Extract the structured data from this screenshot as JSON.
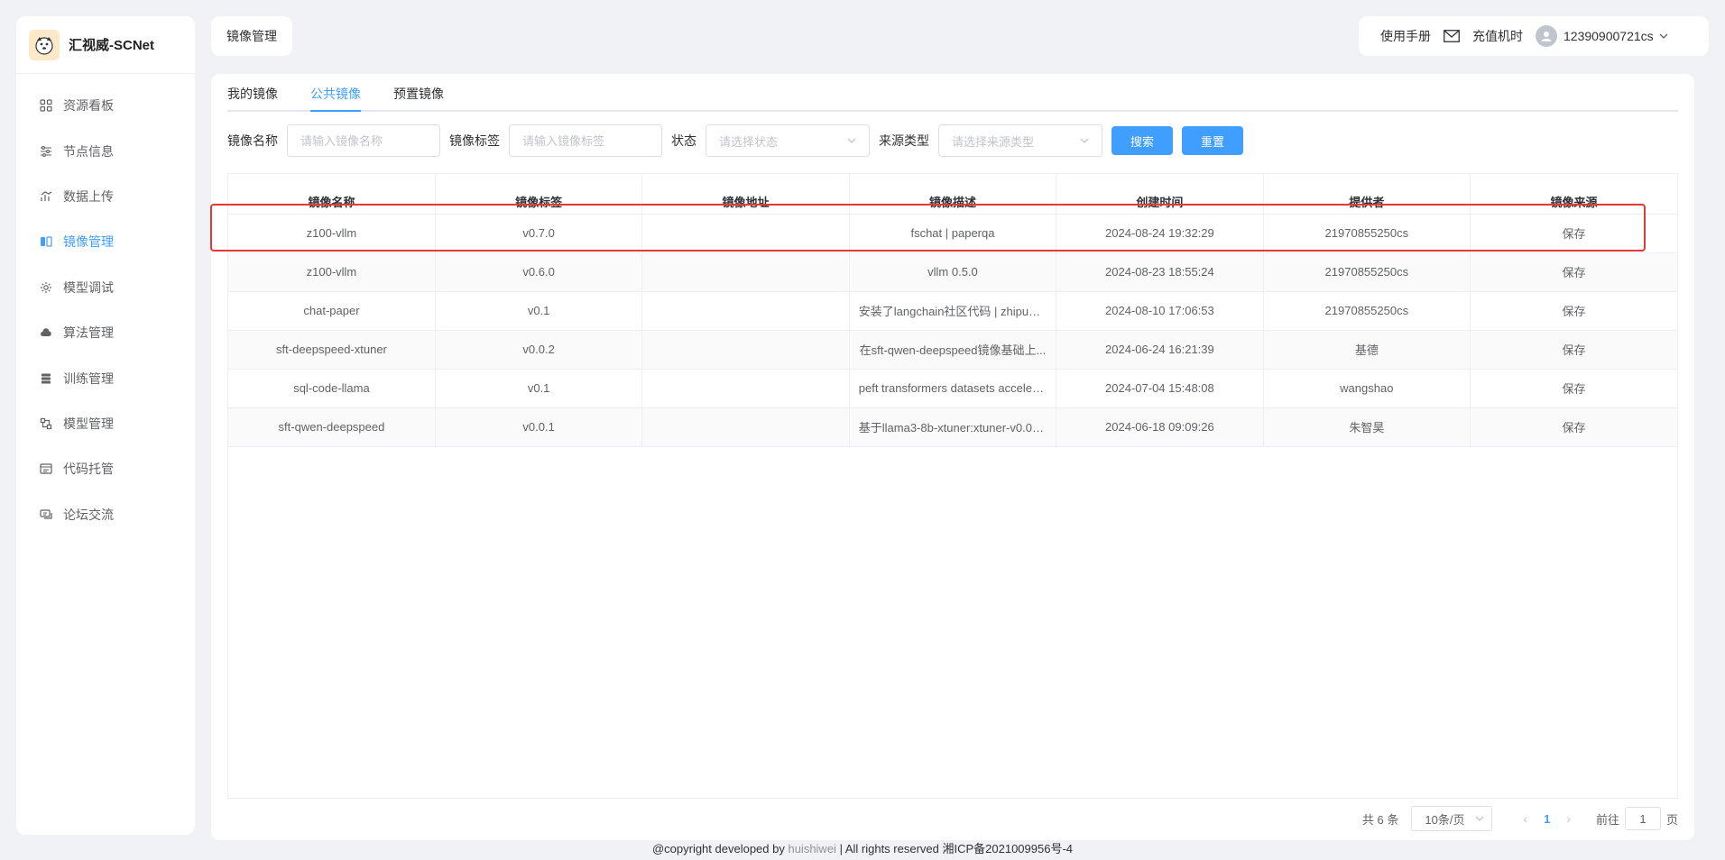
{
  "brand": {
    "title": "汇视威-SCNet"
  },
  "sidebar": {
    "items": [
      {
        "label": "资源看板",
        "icon": "grid-icon",
        "active": false
      },
      {
        "label": "节点信息",
        "icon": "sliders-icon",
        "active": false
      },
      {
        "label": "数据上传",
        "icon": "chart-icon",
        "active": false
      },
      {
        "label": "镜像管理",
        "icon": "mirror-icon",
        "active": true
      },
      {
        "label": "模型调试",
        "icon": "gear-icon",
        "active": false
      },
      {
        "label": "算法管理",
        "icon": "cloud-icon",
        "active": false
      },
      {
        "label": "训练管理",
        "icon": "stack-icon",
        "active": false
      },
      {
        "label": "模型管理",
        "icon": "model-icon",
        "active": false
      },
      {
        "label": "代码托管",
        "icon": "code-icon",
        "active": false
      },
      {
        "label": "论坛交流",
        "icon": "chat-icon",
        "active": false
      }
    ]
  },
  "header": {
    "breadcrumb": "镜像管理",
    "manual": "使用手册",
    "recharge": "充值机时",
    "username": "12390900721cs"
  },
  "tabs": [
    {
      "label": "我的镜像",
      "active": false
    },
    {
      "label": "公共镜像",
      "active": true
    },
    {
      "label": "预置镜像",
      "active": false
    }
  ],
  "filters": {
    "name_label": "镜像名称",
    "name_placeholder": "请输入镜像名称",
    "tag_label": "镜像标签",
    "tag_placeholder": "请输入镜像标签",
    "status_label": "状态",
    "status_placeholder": "请选择状态",
    "source_label": "来源类型",
    "source_placeholder": "请选择来源类型",
    "search_button": "搜索",
    "reset_button": "重置"
  },
  "table": {
    "columns": [
      "镜像名称",
      "镜像标签",
      "镜像地址",
      "镜像描述",
      "创建时间",
      "提供者",
      "镜像来源"
    ],
    "rows": [
      [
        "z100-vllm",
        "v0.7.0",
        "",
        "fschat | paperqa",
        "2024-08-24 19:32:29",
        "21970855250cs",
        "保存"
      ],
      [
        "z100-vllm",
        "v0.6.0",
        "",
        "vllm 0.5.0",
        "2024-08-23 18:55:24",
        "21970855250cs",
        "保存"
      ],
      [
        "chat-paper",
        "v0.1",
        "",
        "安装了langchain社区代码 | zhipuai ...",
        "2024-08-10 17:06:53",
        "21970855250cs",
        "保存"
      ],
      [
        "sft-deepspeed-xtuner",
        "v0.0.2",
        "",
        "在sft-qwen-deepspeed镜像基础上...",
        "2024-06-24 16:21:39",
        "基德",
        "保存"
      ],
      [
        "sql-code-llama",
        "v0.1",
        "",
        "peft transformers datasets accelerate",
        "2024-07-04 15:48:08",
        "wangshao",
        "保存"
      ],
      [
        "sft-qwen-deepspeed",
        "v0.0.1",
        "",
        "基于llama3-8b-xtuner:xtuner-v0.0.1...",
        "2024-06-18 09:09:26",
        "朱智昊",
        "保存"
      ]
    ]
  },
  "pagination": {
    "total": "共 6 条",
    "page_size": "10条/页",
    "prev": "‹",
    "current": "1",
    "next": "›",
    "goto_prefix": "前往",
    "goto_value": "1",
    "goto_suffix": "页"
  },
  "footer": {
    "prefix": "@copyright developed by ",
    "author": "huishiwei",
    "suffix": " | All rights reserved 湘ICP备2021009956号-4"
  },
  "colors": {
    "accent": "#409eff",
    "highlight": "#e53935"
  }
}
